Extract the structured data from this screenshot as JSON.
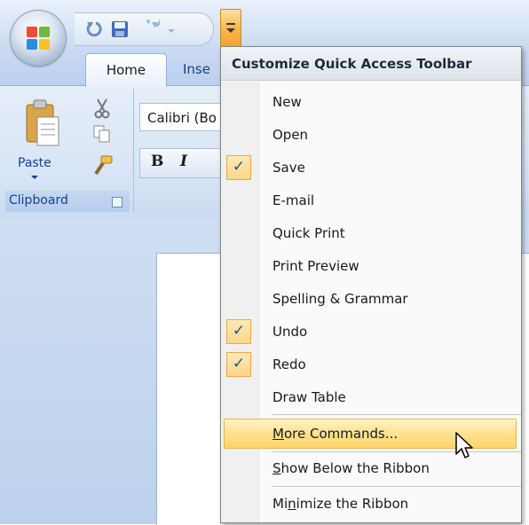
{
  "ribbon": {
    "tabs": {
      "home": "Home",
      "insert_partial": "Inse"
    },
    "clipboard": {
      "paste_label": "Paste",
      "group_label": "Clipboard"
    },
    "font": {
      "name_partial": "Calibri (Bo",
      "bold": "B",
      "italic": "I"
    }
  },
  "menu": {
    "title": "Customize Quick Access Toolbar",
    "items": [
      {
        "label": "New",
        "checked": false
      },
      {
        "label": "Open",
        "checked": false
      },
      {
        "label": "Save",
        "checked": true
      },
      {
        "label": "E-mail",
        "checked": false
      },
      {
        "label": "Quick Print",
        "checked": false
      },
      {
        "label": "Print Preview",
        "checked": false
      },
      {
        "label": "Spelling & Grammar",
        "checked": false
      },
      {
        "label": "Undo",
        "checked": true
      },
      {
        "label": "Redo",
        "checked": true
      },
      {
        "label": "Draw Table",
        "checked": false
      }
    ],
    "more_commands": {
      "mnemonic": "M",
      "rest": "ore Commands..."
    },
    "show_below": {
      "mnemonic": "S",
      "rest": "how Below the Ribbon"
    },
    "minimize": {
      "before": "Mi",
      "mnemonic": "n",
      "after": "imize the Ribbon"
    },
    "check_glyph": "✓"
  },
  "colors": {
    "accent_orange": "#f9b548",
    "highlight_yellow": "#fde28f",
    "ribbon_blue": "#d7e4f5",
    "label_blue": "#15428b"
  },
  "icons": [
    "office-button-icon",
    "undo-icon",
    "save-icon",
    "redo-icon",
    "customize-dropdown-icon",
    "paste-icon",
    "cut-icon",
    "copy-icon",
    "format-painter-icon",
    "dialog-launcher-icon",
    "checkmark-icon",
    "mouse-pointer-icon"
  ]
}
